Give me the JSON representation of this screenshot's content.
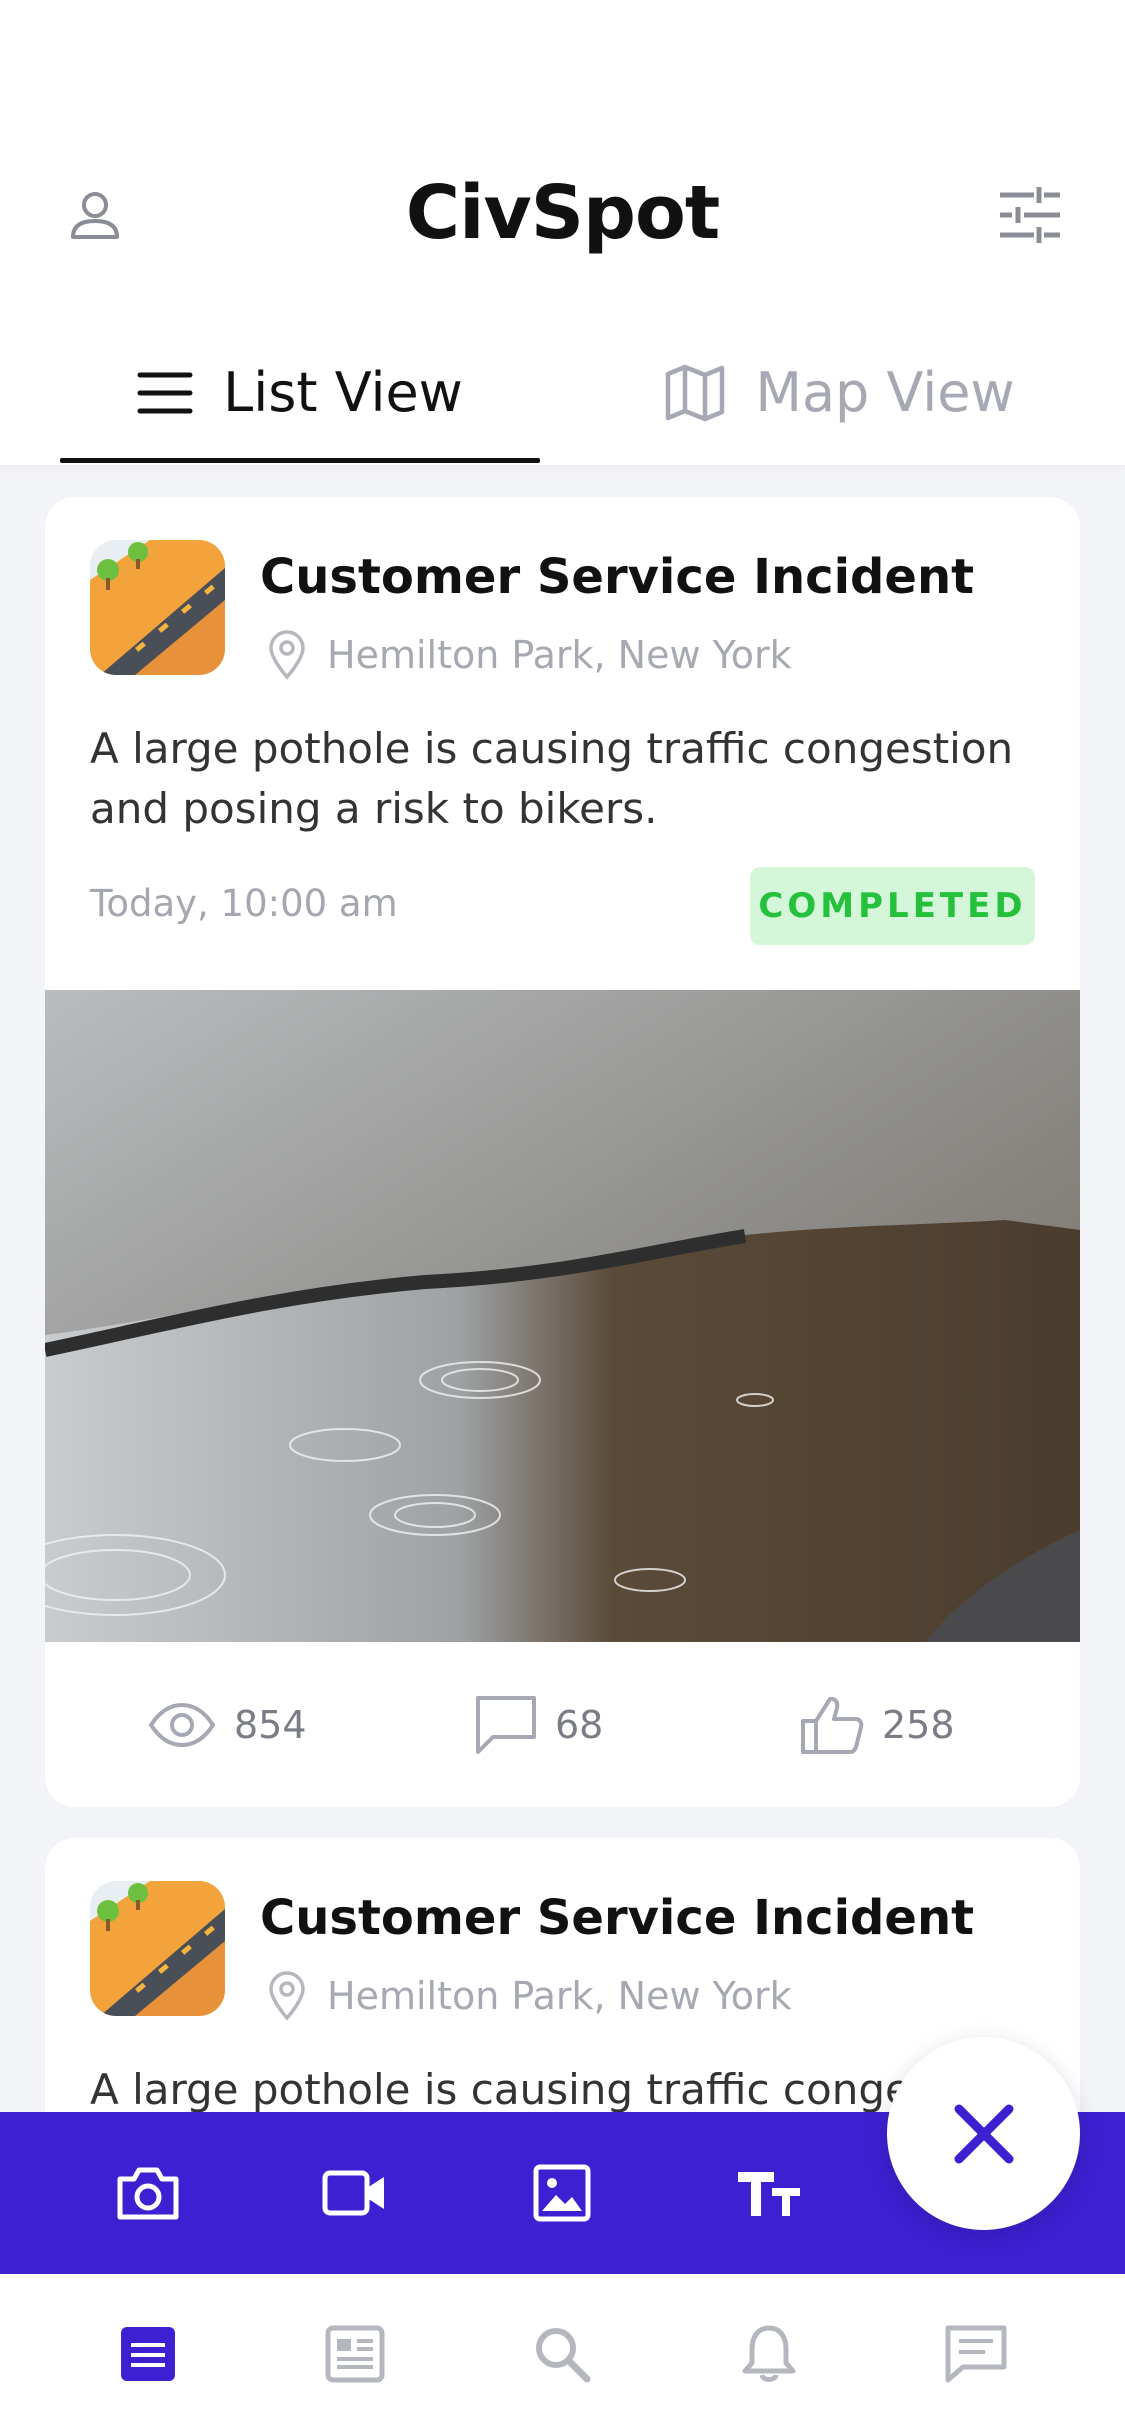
{
  "app": {
    "title": "CivSpot"
  },
  "tabs": [
    {
      "label": "List View",
      "icon": "menu-icon",
      "active": true
    },
    {
      "label": "Map View",
      "icon": "map-icon",
      "active": false
    }
  ],
  "posts": [
    {
      "title": "Customer Service Incident",
      "location": "Hemilton Park, New York",
      "description": "A large pothole is causing traffic congestion and posing a risk to bikers.",
      "time": "Today, 10:00 am",
      "status": "COMPLETED",
      "views": "854",
      "comments": "68",
      "likes": "258"
    },
    {
      "title": "Customer Service Incident",
      "location": "Hemilton Park, New York",
      "description": "A large pothole is causing traffic congestion and posing a risk to bikers."
    }
  ],
  "action_bar": {
    "items": [
      "camera-icon",
      "video-icon",
      "image-icon",
      "text-icon"
    ]
  },
  "bottom_nav": {
    "items": [
      "feed-icon",
      "news-icon",
      "search-icon",
      "bell-icon",
      "chat-icon"
    ],
    "active": "feed-icon"
  },
  "colors": {
    "brand": "#3d20d2",
    "status_bg": "#d4f6d9",
    "status_text": "#25c13c",
    "muted": "#a6a8b3"
  }
}
